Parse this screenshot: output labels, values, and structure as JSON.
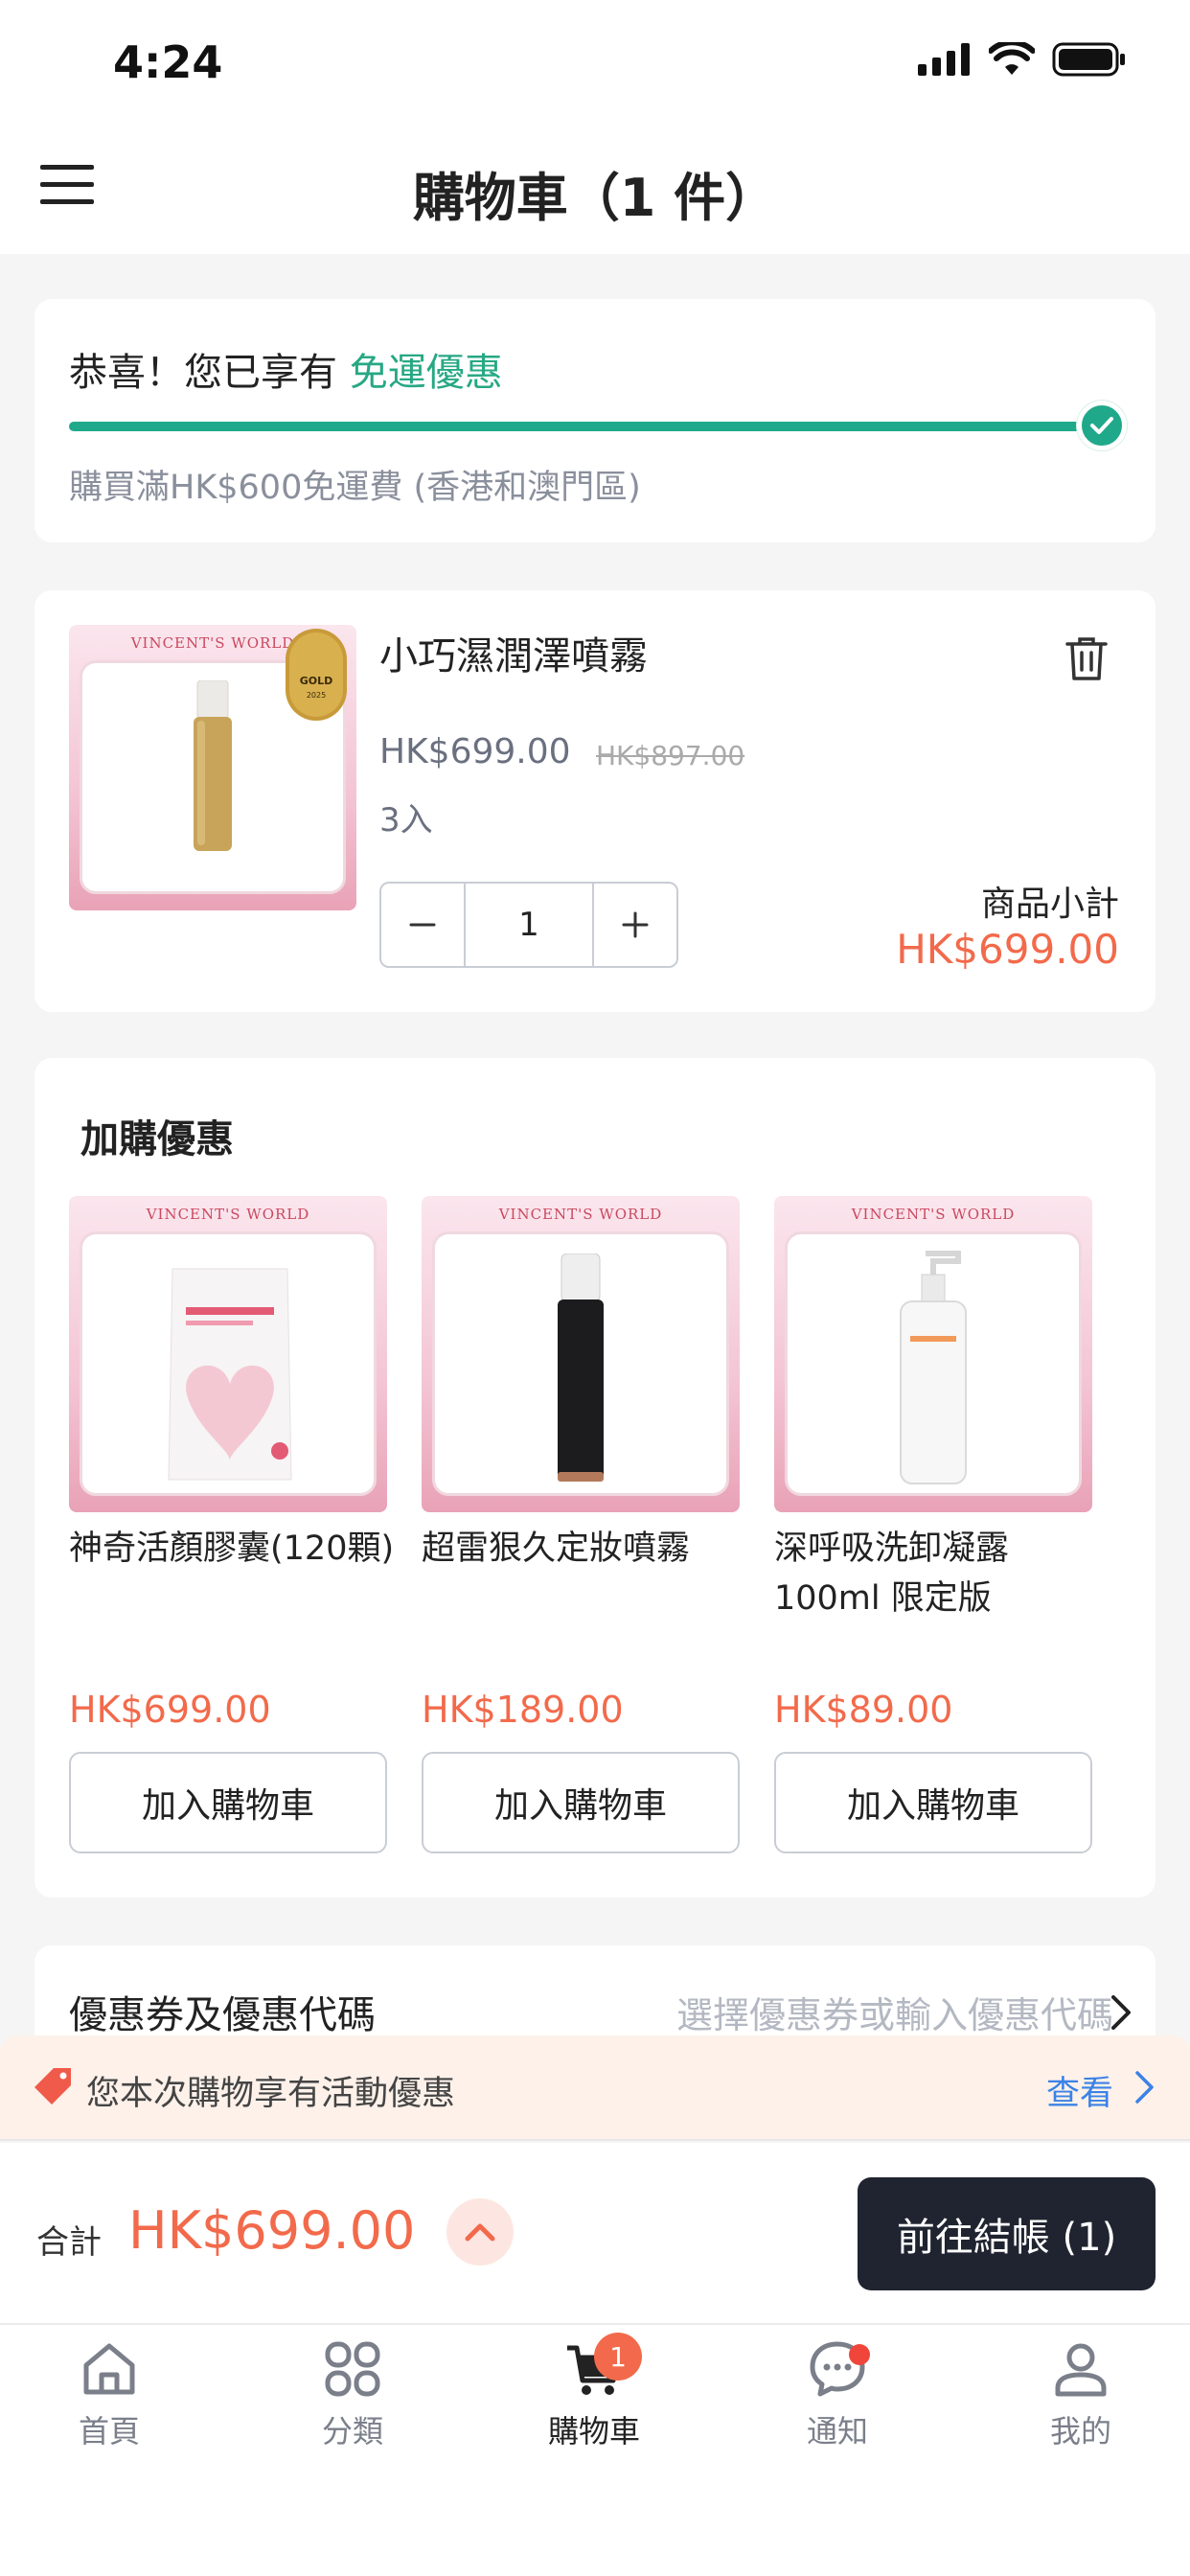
{
  "status_bar": {
    "time": "4:24"
  },
  "header": {
    "title": "購物車（1 件）"
  },
  "shipping": {
    "prefix": "恭喜！您已享有 ",
    "highlight": "免運優惠",
    "note": "購買滿HK$600免運費 (香港和澳門區)",
    "progress": 1.0
  },
  "cart_item": {
    "brand": "VINCENT'S WORLD",
    "name": "小巧濕潤澤噴霧",
    "price": "HK$699.00",
    "original_price": "HK$897.00",
    "variant": "3入",
    "quantity": "1",
    "subtotal_label": "商品小計",
    "subtotal": "HK$699.00"
  },
  "upsell": {
    "title": "加購優惠",
    "items": [
      {
        "brand": "VINCENT'S WORLD",
        "name": "神奇活顏膠囊(120顆)",
        "price": "HK$699.00",
        "button": "加入購物車"
      },
      {
        "brand": "VINCENT'S WORLD",
        "name": "超雷狠久定妝噴霧",
        "price": "HK$189.00",
        "button": "加入購物車"
      },
      {
        "brand": "VINCENT'S WORLD",
        "name": "深呼吸洗卸凝露100ml 限定版",
        "price": "HK$89.00",
        "button": "加入購物車"
      }
    ]
  },
  "coupon": {
    "label": "優惠券及優惠代碼",
    "hint": "選擇優惠券或輸入優惠代碼"
  },
  "promo": {
    "text": "您本次購物享有活動優惠",
    "link": "查看"
  },
  "total": {
    "label": "合計",
    "amount": "HK$699.00",
    "checkout": "前往結帳 (1)"
  },
  "tabs": [
    {
      "label": "首頁",
      "icon": "home-icon"
    },
    {
      "label": "分類",
      "icon": "category-icon"
    },
    {
      "label": "購物車",
      "icon": "cart-icon",
      "badge": "1",
      "active": true
    },
    {
      "label": "通知",
      "icon": "chat-icon"
    },
    {
      "label": "我的",
      "icon": "user-icon"
    }
  ],
  "colors": {
    "accent_green": "#1fa98a",
    "price_orange": "#f26a4b",
    "checkout_dark": "#1f2430",
    "link_blue": "#3b82e6"
  }
}
